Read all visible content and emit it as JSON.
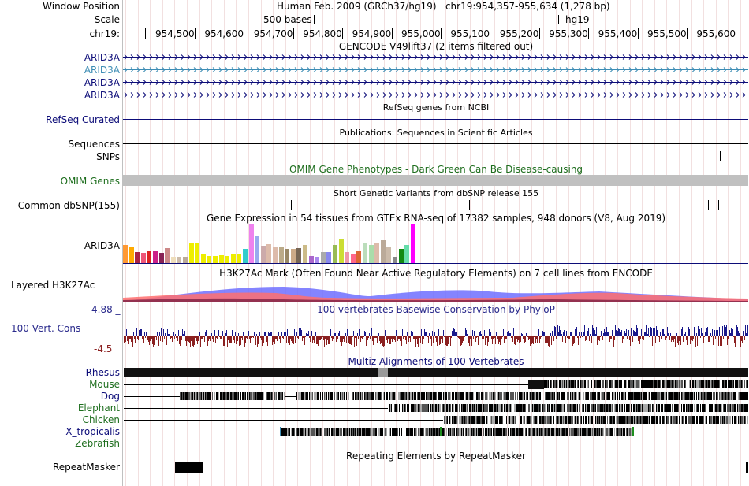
{
  "header": {
    "window_position_label": "Window Position",
    "assembly_text": "Human Feb. 2009 (GRCh37/hg19)   chr19:954,357-955,634 (1,278 bp)",
    "scale_label": "Scale",
    "scale_bar_text": "500 bases",
    "scale_db": "hg19",
    "chrom_label": "chr19:",
    "ruler_ticks": [
      "954,500",
      "954,600",
      "954,700",
      "954,800",
      "954,900",
      "955,000",
      "955,100",
      "955,200",
      "955,300",
      "955,400",
      "955,500",
      "955,600"
    ]
  },
  "tracks": {
    "gencode": {
      "title": "GENCODE V49lift37 (2 items filtered out)",
      "items": [
        {
          "label": "ARID3A",
          "color": "#0c0c78"
        },
        {
          "label": "ARID3A",
          "color": "#3c8cb4"
        },
        {
          "label": "ARID3A",
          "color": "#0c0c78"
        },
        {
          "label": "ARID3A",
          "color": "#0c0c78"
        }
      ]
    },
    "refseq": {
      "title": "RefSeq genes from NCBI",
      "label": "RefSeq Curated",
      "color": "#0c0c78"
    },
    "publications": {
      "title": "Publications: Sequences in Scientific Articles",
      "label": "Sequences"
    },
    "snps": {
      "label": "SNPs"
    },
    "omim": {
      "title": "OMIM Gene Phenotypes - Dark Green Can Be Disease-causing",
      "label": "OMIM Genes",
      "color": "#1e6e1e"
    },
    "dbsnp": {
      "title": "Short Genetic Variants from dbSNP release 155",
      "label": "Common dbSNP(155)"
    },
    "gtex": {
      "title": "Gene Expression in 54 tissues from GTEx RNA-seq of 17382 samples, 948 donors (V8, Aug 2019)",
      "label": "ARID3A",
      "bars": [
        {
          "value": 0.46,
          "color": "#ff9933"
        },
        {
          "value": 0.4,
          "color": "#ffaa00"
        },
        {
          "value": 0.28,
          "color": "#aa2244"
        },
        {
          "value": 0.26,
          "color": "#ee5577"
        },
        {
          "value": 0.3,
          "color": "#dd2222"
        },
        {
          "value": 0.3,
          "color": "#cc2288"
        },
        {
          "value": 0.26,
          "color": "#882255"
        },
        {
          "value": 0.38,
          "color": "#cc8888"
        },
        {
          "value": 0.16,
          "color": "#eeddbb"
        },
        {
          "value": 0.16,
          "color": "#ccbbaa"
        },
        {
          "value": 0.16,
          "color": "#bbaa99"
        },
        {
          "value": 0.5,
          "color": "#eeee00"
        },
        {
          "value": 0.52,
          "color": "#eeee00"
        },
        {
          "value": 0.22,
          "color": "#eeee00"
        },
        {
          "value": 0.18,
          "color": "#eeee00"
        },
        {
          "value": 0.18,
          "color": "#eeee00"
        },
        {
          "value": 0.2,
          "color": "#eeee00"
        },
        {
          "value": 0.18,
          "color": "#eeee00"
        },
        {
          "value": 0.22,
          "color": "#eeee00"
        },
        {
          "value": 0.22,
          "color": "#eeee00"
        },
        {
          "value": 0.36,
          "color": "#33cccc"
        },
        {
          "value": 1.0,
          "color": "#ee82ee"
        },
        {
          "value": 0.68,
          "color": "#99aaee"
        },
        {
          "value": 0.44,
          "color": "#ccaaaa"
        },
        {
          "value": 0.48,
          "color": "#ddbbaa"
        },
        {
          "value": 0.42,
          "color": "#ddbbaa"
        },
        {
          "value": 0.4,
          "color": "#bbaa88"
        },
        {
          "value": 0.36,
          "color": "#998866"
        },
        {
          "value": 0.36,
          "color": "#ccaa88"
        },
        {
          "value": 0.38,
          "color": "#776655"
        },
        {
          "value": 0.46,
          "color": "#ccbb88"
        },
        {
          "value": 0.18,
          "color": "#aa66cc"
        },
        {
          "value": 0.16,
          "color": "#aa88ee"
        },
        {
          "value": 0.28,
          "color": "#aaaaaa"
        },
        {
          "value": 0.28,
          "color": "#8888ee"
        },
        {
          "value": 0.46,
          "color": "#99bb55"
        },
        {
          "value": 0.62,
          "color": "#ccdd33"
        },
        {
          "value": 0.28,
          "color": "#ee99aa"
        },
        {
          "value": 0.22,
          "color": "#ff6688"
        },
        {
          "value": 0.3,
          "color": "#dd6633"
        },
        {
          "value": 0.5,
          "color": "#bbddbb"
        },
        {
          "value": 0.46,
          "color": "#aaddaa"
        },
        {
          "value": 0.5,
          "color": "#ddbbaa"
        },
        {
          "value": 0.58,
          "color": "#bbaa99"
        },
        {
          "value": 0.4,
          "color": "#ccbbaa"
        },
        {
          "value": 0.16,
          "color": "#888888"
        },
        {
          "value": 0.36,
          "color": "#118811"
        },
        {
          "value": 0.46,
          "color": "#66ddaa"
        },
        {
          "value": 0.98,
          "color": "#ff00ff"
        }
      ]
    },
    "h3k27ac": {
      "title": "H3K27Ac Mark (Often Found Near Active Regulatory Elements) on 7 cell lines from ENCODE",
      "label": "Layered H3K27Ac"
    },
    "phylop": {
      "title": "100 vertebrates Basewise Conservation by PhyloP",
      "label": "100 Vert. Cons",
      "max_label": "4.88 _",
      "min_label": "-4.5 _",
      "pos_color": "#1a1a8c",
      "neg_color": "#8b2020"
    },
    "multiz": {
      "title": "Multiz Alignments of 100 Vertebrates",
      "species": [
        {
          "label": "Rhesus",
          "color": "#0c0c78"
        },
        {
          "label": "Mouse",
          "color": "#1e6e1e"
        },
        {
          "label": "Dog",
          "color": "#0c0c78"
        },
        {
          "label": "Elephant",
          "color": "#1e6e1e"
        },
        {
          "label": "Chicken",
          "color": "#1e6e1e"
        },
        {
          "label": "X_tropicalis",
          "color": "#0c0c78"
        },
        {
          "label": "Zebrafish",
          "color": "#1e6e1e"
        }
      ]
    },
    "repeatmasker": {
      "title": "Repeating Elements by RepeatMasker",
      "label": "RepeatMasker"
    }
  }
}
